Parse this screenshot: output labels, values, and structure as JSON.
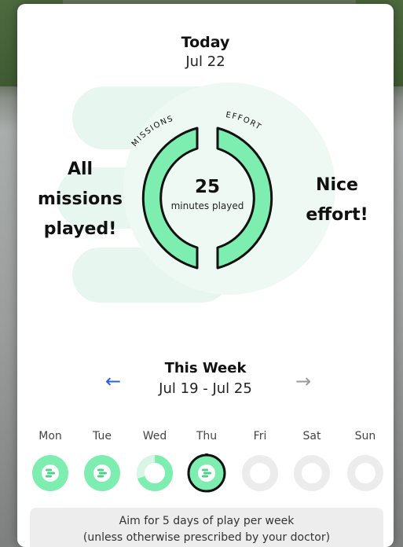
{
  "today": {
    "title": "Today",
    "date": "Jul 22"
  },
  "summary": {
    "minutes": "25",
    "minutes_label": "minutes played",
    "missions_arc_label": "MISSIONS",
    "effort_arc_label": "EFFORT",
    "left_message_lines": [
      "All",
      "missions",
      "played!"
    ],
    "right_message_lines": [
      "Nice",
      "effort!"
    ]
  },
  "week": {
    "title": "This Week",
    "range": "Jul 19 - Jul 25",
    "days": [
      {
        "label": "Mon",
        "status": "done"
      },
      {
        "label": "Tue",
        "status": "done"
      },
      {
        "label": "Wed",
        "status": "partial",
        "fraction": 0.7
      },
      {
        "label": "Thu",
        "status": "today"
      },
      {
        "label": "Fri",
        "status": "empty"
      },
      {
        "label": "Sat",
        "status": "empty"
      },
      {
        "label": "Sun",
        "status": "empty"
      }
    ]
  },
  "tip": {
    "line1": "Aim for 5 days of play per week",
    "line2": "(unless otherwise prescribed by your doctor)"
  },
  "colors": {
    "accent_green": "#7eeeb0",
    "light_green": "#e6f7ef",
    "nav_blue": "#2f5fd8"
  }
}
